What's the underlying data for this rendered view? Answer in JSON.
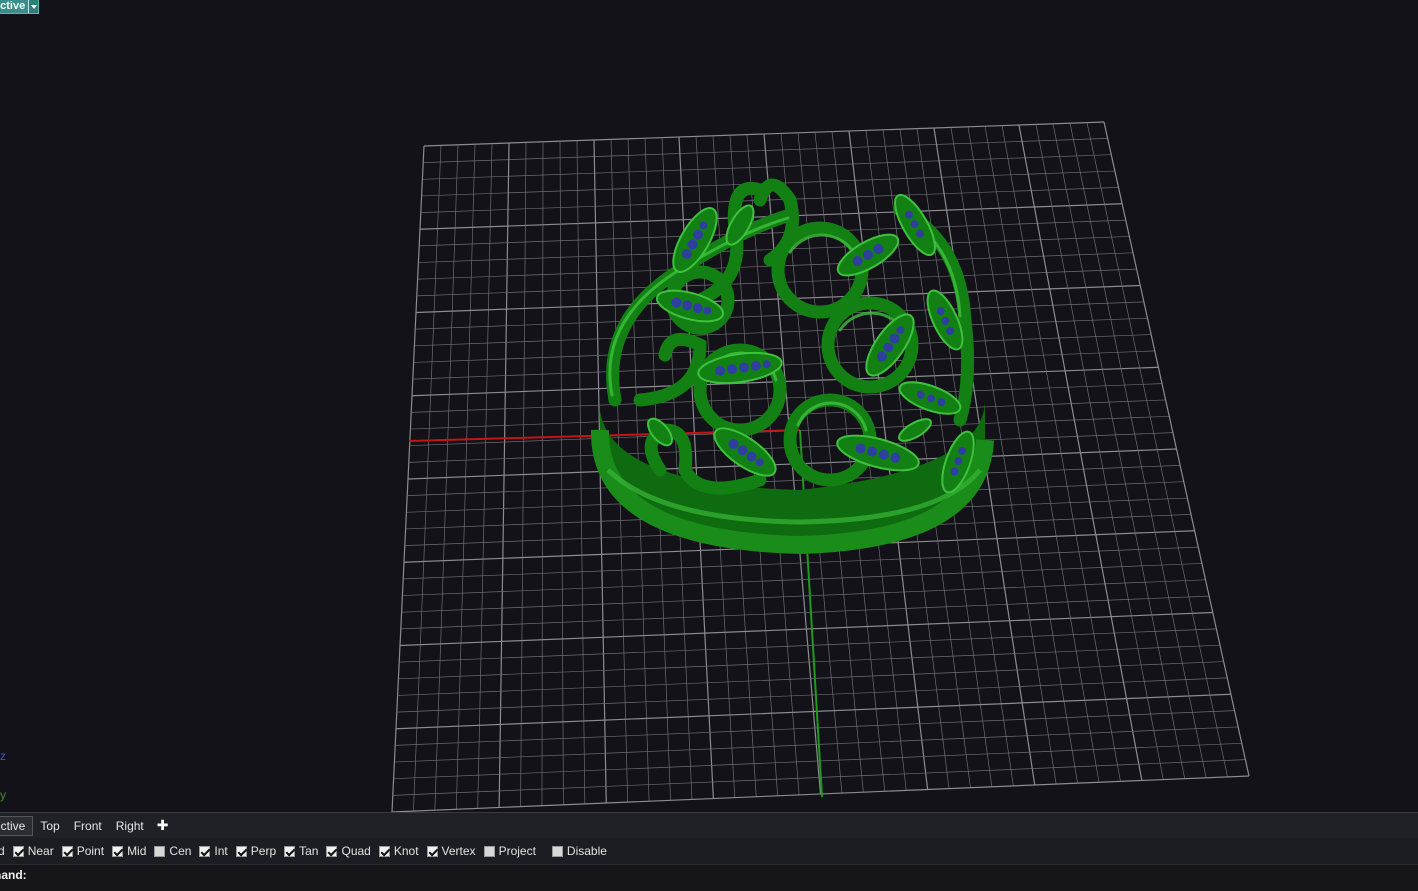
{
  "viewport": {
    "name": "Perspective",
    "name_visible": "ective",
    "axis_z_label": "z",
    "axis_y_label": "y",
    "colors": {
      "background": "#131218",
      "grid_line": "#6d6d72",
      "grid_major": "#8c8c90",
      "x_axis": "#c41515",
      "y_axis": "#1f9a1f",
      "model_body": "#157d15",
      "model_highlight": "#3ec23e",
      "gem": "#2f3fa0"
    },
    "model": "green filigree ring with leaf vines and blue stones"
  },
  "tabs": [
    {
      "label": "ective",
      "active": true
    },
    {
      "label": "Top",
      "active": false
    },
    {
      "label": "Front",
      "active": false
    },
    {
      "label": "Right",
      "active": false
    }
  ],
  "add_tab_label": "✚",
  "osnaps": [
    {
      "label": "d",
      "checked": null
    },
    {
      "label": "Near",
      "checked": true
    },
    {
      "label": "Point",
      "checked": true
    },
    {
      "label": "Mid",
      "checked": true
    },
    {
      "label": "Cen",
      "checked": false
    },
    {
      "label": "Int",
      "checked": true
    },
    {
      "label": "Perp",
      "checked": true
    },
    {
      "label": "Tan",
      "checked": true
    },
    {
      "label": "Quad",
      "checked": true
    },
    {
      "label": "Knot",
      "checked": true
    },
    {
      "label": "Vertex",
      "checked": true
    },
    {
      "label": "Project",
      "checked": false
    },
    {
      "label": "Disable",
      "checked": false
    }
  ],
  "command": {
    "prompt": "nand:"
  }
}
